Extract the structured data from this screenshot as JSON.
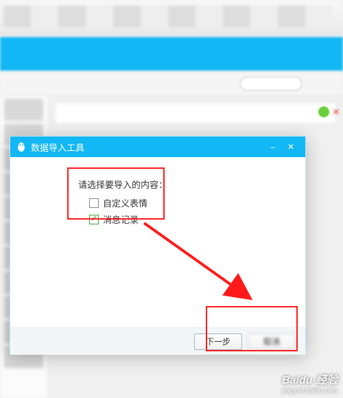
{
  "dialog": {
    "title": "数据导入工具",
    "prompt": "请选择要导入的内容：",
    "options": {
      "custom_emoji": {
        "label": "自定义表情",
        "checked": false
      },
      "message_history": {
        "label": "消息记录",
        "checked": true
      }
    },
    "next_button": "下一步",
    "cancel_button": "取消"
  },
  "watermark": {
    "brand": "Baidu 经验",
    "url": "jingyan.baidu.com"
  }
}
